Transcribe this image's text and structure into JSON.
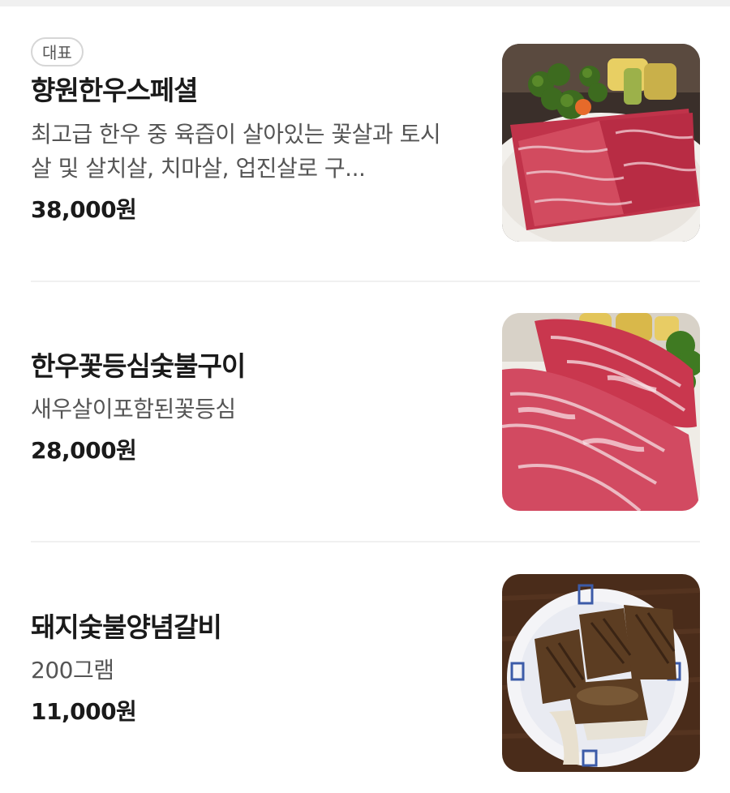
{
  "menu": {
    "items": [
      {
        "badge": "대표",
        "name": "향원한우스페셜",
        "description": "최고급 한우 중 육즙이 살아있는 꽃살과 토시살 및 살치살, 치마살, 업진살로 구...",
        "price": "38,000원",
        "image": "assorted-marbled-hanwoo-beef-plate"
      },
      {
        "name": "한우꽃등심숯불구이",
        "description": "새우살이포함된꽃등심",
        "price": "28,000원",
        "image": "marbled-ribeye-plate"
      },
      {
        "name": "돼지숯불양념갈비",
        "description": "200그램",
        "price": "11,000원",
        "image": "grilled-pork-ribs-plate"
      }
    ]
  }
}
